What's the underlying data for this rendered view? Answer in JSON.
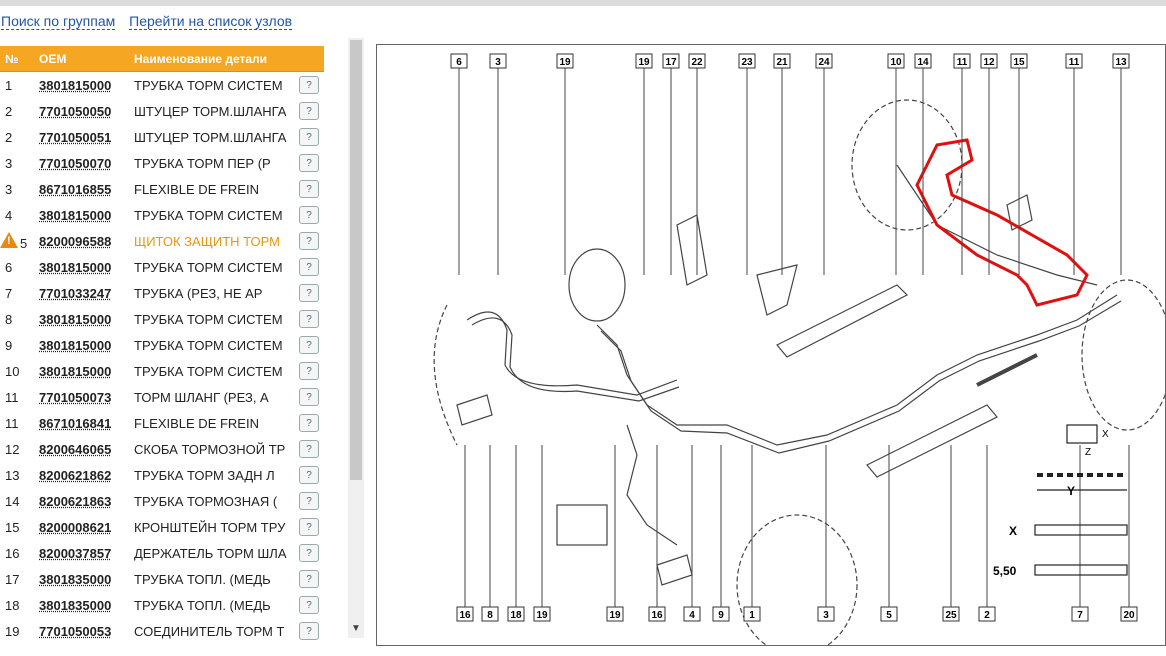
{
  "nav": {
    "link_groups": "Поиск по группам",
    "link_nodes": "Перейти на список узлов"
  },
  "table": {
    "headers": {
      "no": "№",
      "oem": "OEM",
      "name": "Наименование детали"
    },
    "rows": [
      {
        "no": "1",
        "oem": "3801815000",
        "name": "ТРУБКА ТОРМ СИСТЕМ"
      },
      {
        "no": "2",
        "oem": "7701050050",
        "name": "ШТУЦЕР ТОРМ.ШЛАНГА"
      },
      {
        "no": "2",
        "oem": "7701050051",
        "name": "ШТУЦЕР ТОРМ.ШЛАНГА"
      },
      {
        "no": "3",
        "oem": "7701050070",
        "name": "ТРУБКА ТОРМ ПЕР (Р"
      },
      {
        "no": "3",
        "oem": "8671016855",
        "name": "FLEXIBLE DE FREIN"
      },
      {
        "no": "4",
        "oem": "3801815000",
        "name": "ТРУБКА ТОРМ СИСТЕМ"
      },
      {
        "no": "5",
        "oem": "8200096588",
        "name": "ЩИТОК ЗАЩИТН ТОРМ",
        "warning": true
      },
      {
        "no": "6",
        "oem": "3801815000",
        "name": "ТРУБКА ТОРМ СИСТЕМ"
      },
      {
        "no": "7",
        "oem": "7701033247",
        "name": "ТРУБКА (РЕЗ, НЕ АР"
      },
      {
        "no": "8",
        "oem": "3801815000",
        "name": "ТРУБКА ТОРМ СИСТЕМ"
      },
      {
        "no": "9",
        "oem": "3801815000",
        "name": "ТРУБКА ТОРМ СИСТЕМ"
      },
      {
        "no": "10",
        "oem": "3801815000",
        "name": "ТРУБКА ТОРМ СИСТЕМ"
      },
      {
        "no": "11",
        "oem": "7701050073",
        "name": "ТОРМ ШЛАНГ (РЕЗ, А"
      },
      {
        "no": "11",
        "oem": "8671016841",
        "name": "FLEXIBLE DE FREIN"
      },
      {
        "no": "12",
        "oem": "8200646065",
        "name": "СКОБА ТОРМОЗНОЙ ТР"
      },
      {
        "no": "13",
        "oem": "8200621862",
        "name": "ТРУБКА ТОРМ ЗАДН Л"
      },
      {
        "no": "14",
        "oem": "8200621863",
        "name": "ТРУБКА ТОРМОЗНАЯ ("
      },
      {
        "no": "15",
        "oem": "8200008621",
        "name": "КРОНШТЕЙН ТОРМ ТРУ"
      },
      {
        "no": "16",
        "oem": "8200037857",
        "name": "ДЕРЖАТЕЛЬ ТОРМ ШЛА"
      },
      {
        "no": "17",
        "oem": "3801835000",
        "name": "ТРУБКА ТОПЛ. (МЕДЬ"
      },
      {
        "no": "18",
        "oem": "3801835000",
        "name": "ТРУБКА ТОПЛ. (МЕДЬ"
      },
      {
        "no": "19",
        "oem": "7701050053",
        "name": "СОЕДИНИТЕЛЬ ТОРМ Т"
      }
    ]
  },
  "diagram": {
    "top_callouts": [
      "6",
      "3",
      "19",
      "19",
      "17",
      "22",
      "23",
      "21",
      "24",
      "10",
      "14",
      "11",
      "12",
      "15",
      "11",
      "13"
    ],
    "bottom_callouts": [
      "16",
      "8",
      "18",
      "19",
      "19",
      "16",
      "4",
      "9",
      "1",
      "3",
      "5",
      "25",
      "2",
      "7",
      "20"
    ],
    "dim_labels": {
      "x": "X",
      "z": "Z",
      "y": "Y",
      "x2": "X",
      "val": "5,50"
    }
  }
}
